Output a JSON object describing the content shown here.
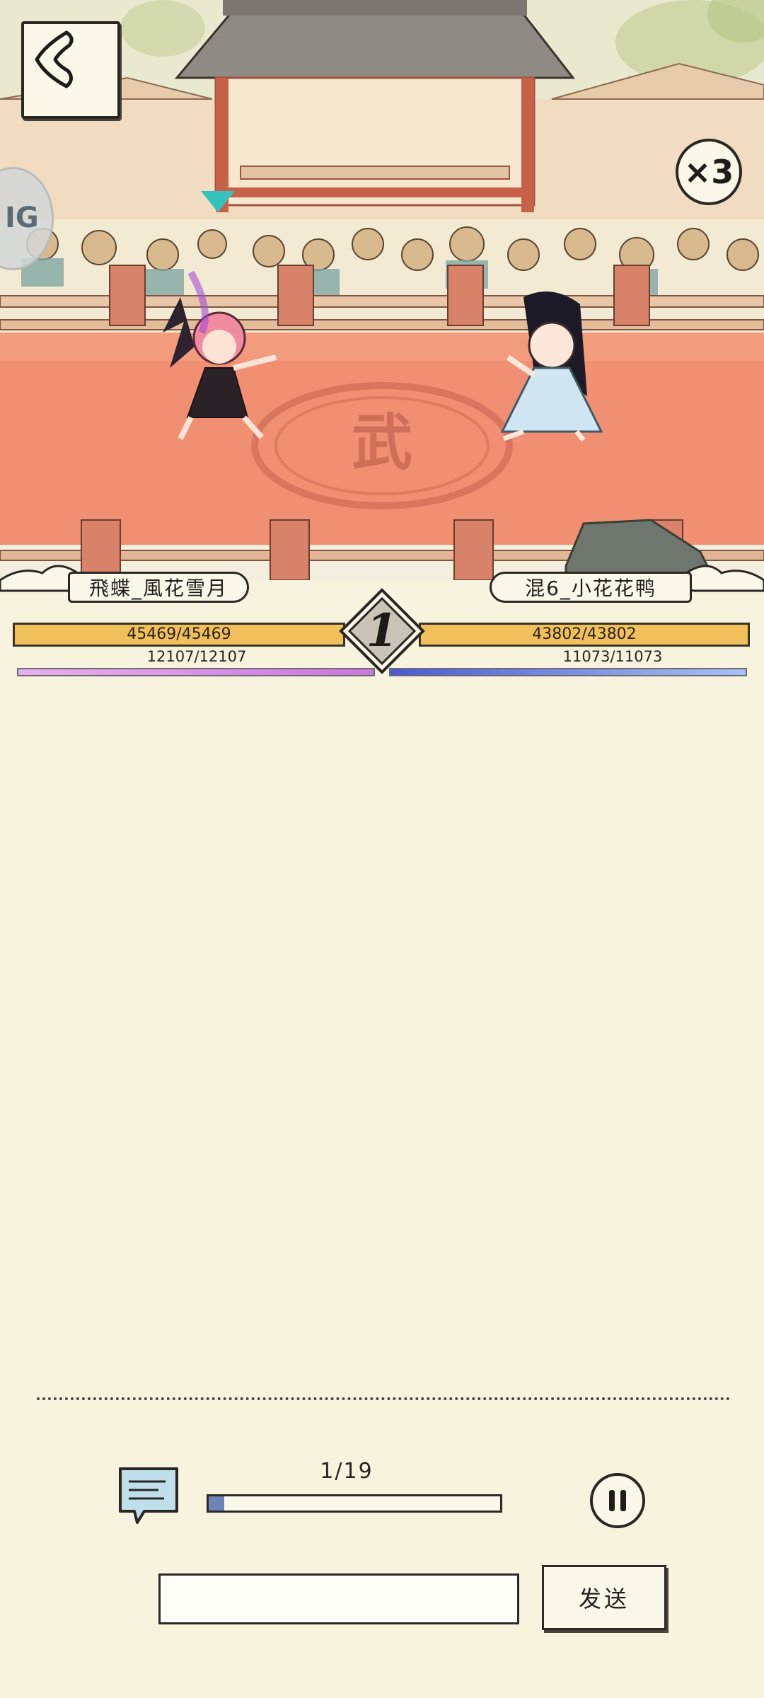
{
  "arena": {
    "floor_glyph": "武",
    "speed_label": "×3",
    "side_button_label": "IG"
  },
  "players": {
    "left": {
      "name": "飛蝶_風花雪月",
      "hp_text": "45469/45469",
      "hp_fraction": 1.0,
      "mp_text": "12107/12107",
      "mp_fraction": 1.0,
      "hp_color": "#f2c05a",
      "mp_color": "#c878d8"
    },
    "right": {
      "name": "混6_小花花鸭",
      "hp_text": "43802/43802",
      "hp_fraction": 1.0,
      "mp_text": "11073/11073",
      "mp_fraction": 1.0,
      "hp_color": "#f2c05a",
      "mp_color": "#4a5ccf"
    }
  },
  "round": {
    "number": "1"
  },
  "playback": {
    "progress_text": "1/19",
    "progress_fraction": 0.053
  },
  "chat": {
    "input_value": "",
    "send_label": "发送"
  },
  "icons": {
    "back": "chevron-left-icon",
    "chat": "chat-log-icon",
    "pause": "pause-icon"
  }
}
